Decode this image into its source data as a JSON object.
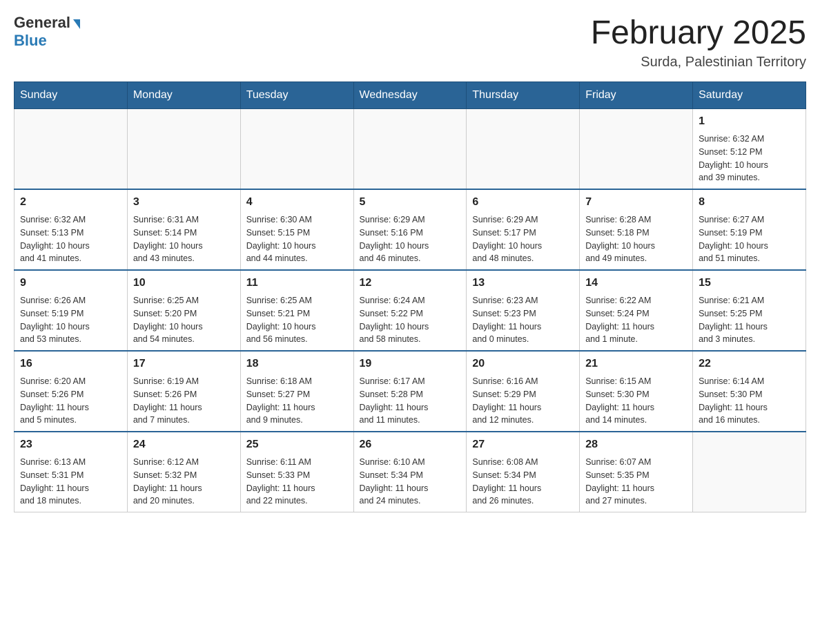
{
  "logo": {
    "general": "General",
    "blue": "Blue"
  },
  "title": "February 2025",
  "subtitle": "Surda, Palestinian Territory",
  "headers": [
    "Sunday",
    "Monday",
    "Tuesday",
    "Wednesday",
    "Thursday",
    "Friday",
    "Saturday"
  ],
  "weeks": [
    {
      "days": [
        {
          "num": "",
          "info": ""
        },
        {
          "num": "",
          "info": ""
        },
        {
          "num": "",
          "info": ""
        },
        {
          "num": "",
          "info": ""
        },
        {
          "num": "",
          "info": ""
        },
        {
          "num": "",
          "info": ""
        },
        {
          "num": "1",
          "info": "Sunrise: 6:32 AM\nSunset: 5:12 PM\nDaylight: 10 hours\nand 39 minutes."
        }
      ]
    },
    {
      "days": [
        {
          "num": "2",
          "info": "Sunrise: 6:32 AM\nSunset: 5:13 PM\nDaylight: 10 hours\nand 41 minutes."
        },
        {
          "num": "3",
          "info": "Sunrise: 6:31 AM\nSunset: 5:14 PM\nDaylight: 10 hours\nand 43 minutes."
        },
        {
          "num": "4",
          "info": "Sunrise: 6:30 AM\nSunset: 5:15 PM\nDaylight: 10 hours\nand 44 minutes."
        },
        {
          "num": "5",
          "info": "Sunrise: 6:29 AM\nSunset: 5:16 PM\nDaylight: 10 hours\nand 46 minutes."
        },
        {
          "num": "6",
          "info": "Sunrise: 6:29 AM\nSunset: 5:17 PM\nDaylight: 10 hours\nand 48 minutes."
        },
        {
          "num": "7",
          "info": "Sunrise: 6:28 AM\nSunset: 5:18 PM\nDaylight: 10 hours\nand 49 minutes."
        },
        {
          "num": "8",
          "info": "Sunrise: 6:27 AM\nSunset: 5:19 PM\nDaylight: 10 hours\nand 51 minutes."
        }
      ]
    },
    {
      "days": [
        {
          "num": "9",
          "info": "Sunrise: 6:26 AM\nSunset: 5:19 PM\nDaylight: 10 hours\nand 53 minutes."
        },
        {
          "num": "10",
          "info": "Sunrise: 6:25 AM\nSunset: 5:20 PM\nDaylight: 10 hours\nand 54 minutes."
        },
        {
          "num": "11",
          "info": "Sunrise: 6:25 AM\nSunset: 5:21 PM\nDaylight: 10 hours\nand 56 minutes."
        },
        {
          "num": "12",
          "info": "Sunrise: 6:24 AM\nSunset: 5:22 PM\nDaylight: 10 hours\nand 58 minutes."
        },
        {
          "num": "13",
          "info": "Sunrise: 6:23 AM\nSunset: 5:23 PM\nDaylight: 11 hours\nand 0 minutes."
        },
        {
          "num": "14",
          "info": "Sunrise: 6:22 AM\nSunset: 5:24 PM\nDaylight: 11 hours\nand 1 minute."
        },
        {
          "num": "15",
          "info": "Sunrise: 6:21 AM\nSunset: 5:25 PM\nDaylight: 11 hours\nand 3 minutes."
        }
      ]
    },
    {
      "days": [
        {
          "num": "16",
          "info": "Sunrise: 6:20 AM\nSunset: 5:26 PM\nDaylight: 11 hours\nand 5 minutes."
        },
        {
          "num": "17",
          "info": "Sunrise: 6:19 AM\nSunset: 5:26 PM\nDaylight: 11 hours\nand 7 minutes."
        },
        {
          "num": "18",
          "info": "Sunrise: 6:18 AM\nSunset: 5:27 PM\nDaylight: 11 hours\nand 9 minutes."
        },
        {
          "num": "19",
          "info": "Sunrise: 6:17 AM\nSunset: 5:28 PM\nDaylight: 11 hours\nand 11 minutes."
        },
        {
          "num": "20",
          "info": "Sunrise: 6:16 AM\nSunset: 5:29 PM\nDaylight: 11 hours\nand 12 minutes."
        },
        {
          "num": "21",
          "info": "Sunrise: 6:15 AM\nSunset: 5:30 PM\nDaylight: 11 hours\nand 14 minutes."
        },
        {
          "num": "22",
          "info": "Sunrise: 6:14 AM\nSunset: 5:30 PM\nDaylight: 11 hours\nand 16 minutes."
        }
      ]
    },
    {
      "days": [
        {
          "num": "23",
          "info": "Sunrise: 6:13 AM\nSunset: 5:31 PM\nDaylight: 11 hours\nand 18 minutes."
        },
        {
          "num": "24",
          "info": "Sunrise: 6:12 AM\nSunset: 5:32 PM\nDaylight: 11 hours\nand 20 minutes."
        },
        {
          "num": "25",
          "info": "Sunrise: 6:11 AM\nSunset: 5:33 PM\nDaylight: 11 hours\nand 22 minutes."
        },
        {
          "num": "26",
          "info": "Sunrise: 6:10 AM\nSunset: 5:34 PM\nDaylight: 11 hours\nand 24 minutes."
        },
        {
          "num": "27",
          "info": "Sunrise: 6:08 AM\nSunset: 5:34 PM\nDaylight: 11 hours\nand 26 minutes."
        },
        {
          "num": "28",
          "info": "Sunrise: 6:07 AM\nSunset: 5:35 PM\nDaylight: 11 hours\nand 27 minutes."
        },
        {
          "num": "",
          "info": ""
        }
      ]
    }
  ]
}
